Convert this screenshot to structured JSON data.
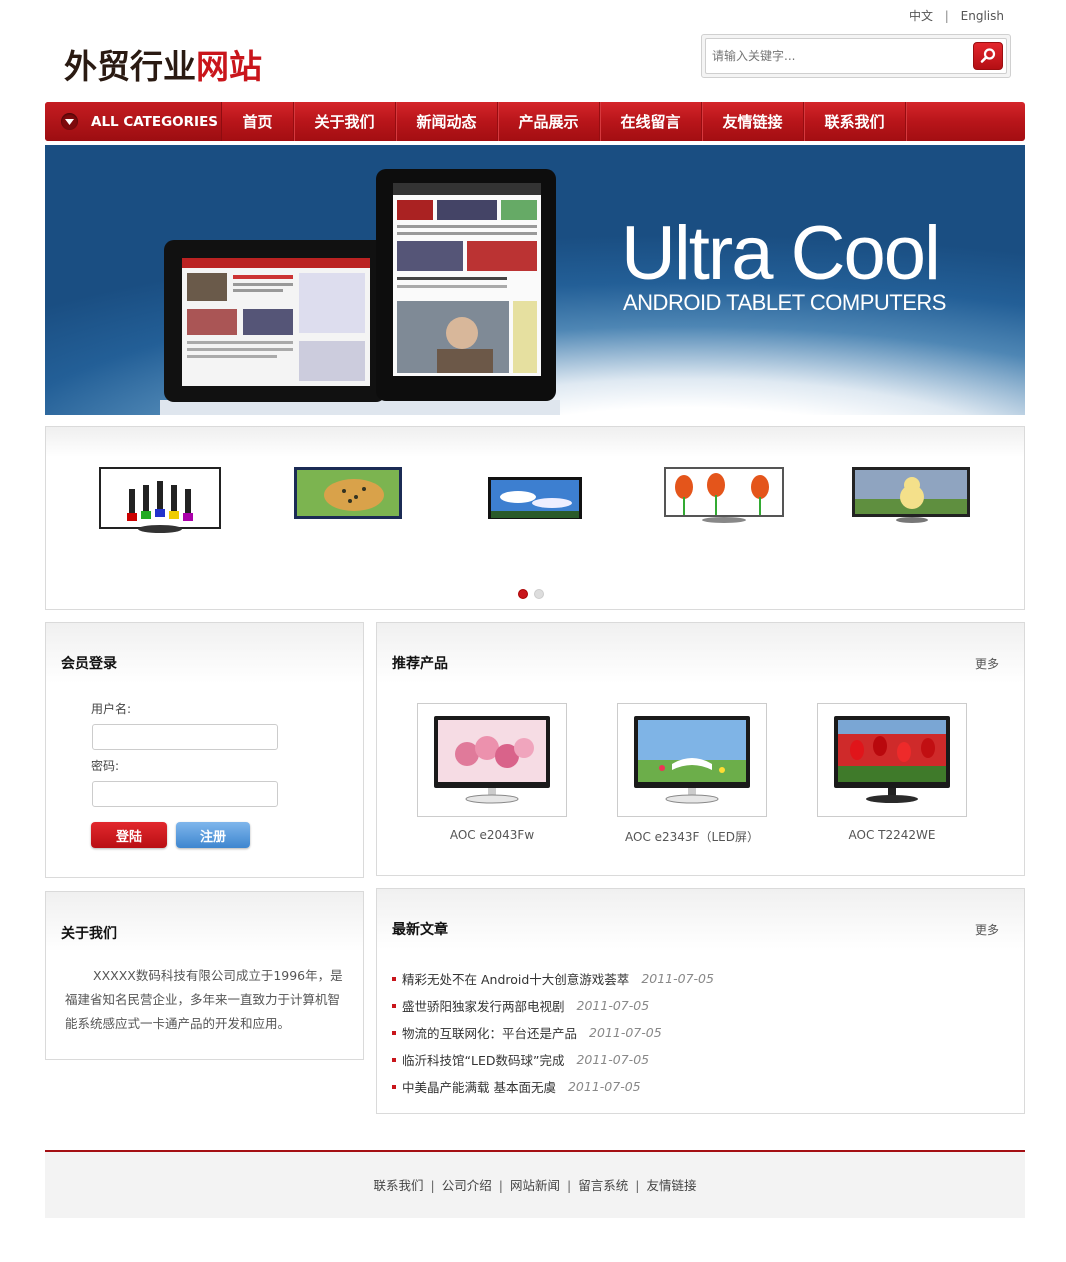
{
  "lang": {
    "cn": "中文",
    "sep": "|",
    "en": "English"
  },
  "logo": {
    "part1": "外贸行业",
    "part2": "网站"
  },
  "search": {
    "placeholder": "请输入关键字..."
  },
  "nav": {
    "categories": "ALL CATEGORIES",
    "items": [
      "首页",
      "关于我们",
      "新闻动态",
      "产品展示",
      "在线留言",
      "友情链接",
      "联系我们"
    ]
  },
  "banner": {
    "title": "Ultra Cool",
    "subtitle": "ANDROID TABLET COMPUTERS"
  },
  "carousel": {
    "slides": 2,
    "active": 1
  },
  "login": {
    "title": "会员登录",
    "username_label": "用户名:",
    "password_label": "密码:",
    "login_button": "登陆",
    "register_button": "注册"
  },
  "about": {
    "title": "关于我们",
    "text": "XXXXX数码科技有限公司成立于1996年，是福建省知名民营企业，多年来一直致力于计算机智能系统感应式一卡通产品的开发和应用。"
  },
  "products": {
    "title": "推荐产品",
    "more": "更多",
    "items": [
      {
        "name": "AOC e2043Fw"
      },
      {
        "name": "AOC e2343F（LED屏）"
      },
      {
        "name": "AOC T2242WE"
      }
    ]
  },
  "articles": {
    "title": "最新文章",
    "more": "更多",
    "items": [
      {
        "title": "精彩无处不在 Android十大创意游戏荟萃",
        "date": "2011-07-05"
      },
      {
        "title": "盛世骄阳独家发行两部电视剧",
        "date": "2011-07-05"
      },
      {
        "title": "物流的互联网化：平台还是产品",
        "date": "2011-07-05"
      },
      {
        "title": "临沂科技馆“LED数码球”完成",
        "date": "2011-07-05"
      },
      {
        "title": "中美晶产能满载 基本面无虞",
        "date": "2011-07-05"
      }
    ]
  },
  "footer": {
    "links": [
      "联系我们",
      "公司介绍",
      "网站新闻",
      "留言系统",
      "友情链接"
    ],
    "sep": "|"
  },
  "colors": {
    "accent": "#c8151b",
    "nav_dark": "#a30e12",
    "banner_blue": "#235f97"
  }
}
